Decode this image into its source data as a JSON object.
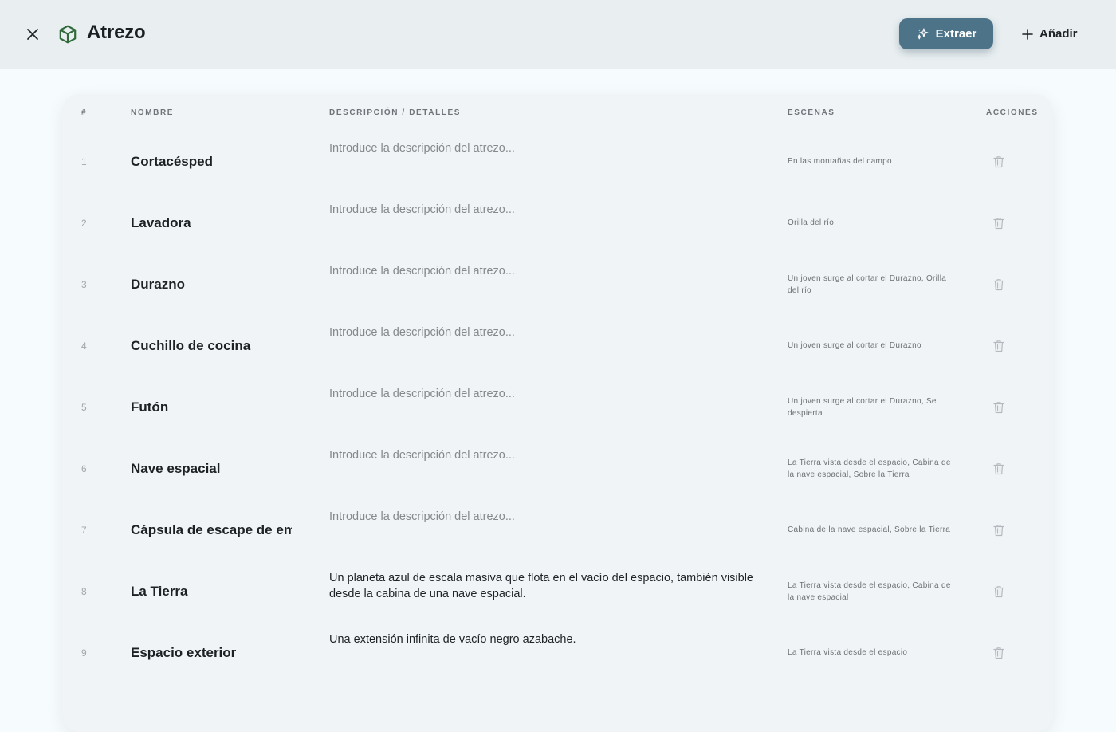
{
  "header": {
    "title": "Atrezo",
    "extract_label": "Extraer",
    "add_label": "Añadir"
  },
  "colors": {
    "accent": "#4d7388",
    "header_bg": "#e9eff1",
    "card_bg": "#f1f4f7",
    "icon_green": "#2f6b3a"
  },
  "table": {
    "columns": {
      "num": "#",
      "name": "NOMBRE",
      "description": "DESCRIPCIÓN / DETALLES",
      "scenes": "ESCENAS",
      "actions": "ACCIONES"
    },
    "rows": [
      {
        "num": "1",
        "name": "Cortacésped",
        "description": "",
        "placeholder": "Introduce la descripción del atrezo...",
        "scenes": "En las montañas del campo"
      },
      {
        "num": "2",
        "name": "Lavadora",
        "description": "",
        "placeholder": "Introduce la descripción del atrezo...",
        "scenes": "Orilla del río"
      },
      {
        "num": "3",
        "name": "Durazno",
        "description": "",
        "placeholder": "Introduce la descripción del atrezo...",
        "scenes": "Un joven surge al cortar el Durazno, Orilla del río"
      },
      {
        "num": "4",
        "name": "Cuchillo de cocina",
        "description": "",
        "placeholder": "Introduce la descripción del atrezo...",
        "scenes": "Un joven surge al cortar el Durazno"
      },
      {
        "num": "5",
        "name": "Futón",
        "description": "",
        "placeholder": "Introduce la descripción del atrezo...",
        "scenes": "Un joven surge al cortar el Durazno, Se despierta"
      },
      {
        "num": "6",
        "name": "Nave espacial",
        "description": "",
        "placeholder": "Introduce la descripción del atrezo...",
        "scenes": "La Tierra vista desde el espacio, Cabina de la nave espacial, Sobre la Tierra"
      },
      {
        "num": "7",
        "name": "Cápsula de escape de emergencia",
        "description": "",
        "placeholder": "Introduce la descripción del atrezo...",
        "scenes": "Cabina de la nave espacial, Sobre la Tierra"
      },
      {
        "num": "8",
        "name": "La Tierra",
        "description": "Un planeta azul de escala masiva que flota en el vacío del espacio, también visible desde la cabina de una nave espacial.",
        "placeholder": "Introduce la descripción del atrezo...",
        "scenes": "La Tierra vista desde el espacio, Cabina de la nave espacial"
      },
      {
        "num": "9",
        "name": "Espacio exterior",
        "description": "Una extensión infinita de vacío negro azabache.",
        "placeholder": "Introduce la descripción del atrezo...",
        "scenes": "La Tierra vista desde el espacio"
      }
    ]
  },
  "icons": {
    "close": "close-icon",
    "title": "cube-icon",
    "extract": "sparkles-icon",
    "add": "plus-icon",
    "delete": "trash-icon"
  }
}
